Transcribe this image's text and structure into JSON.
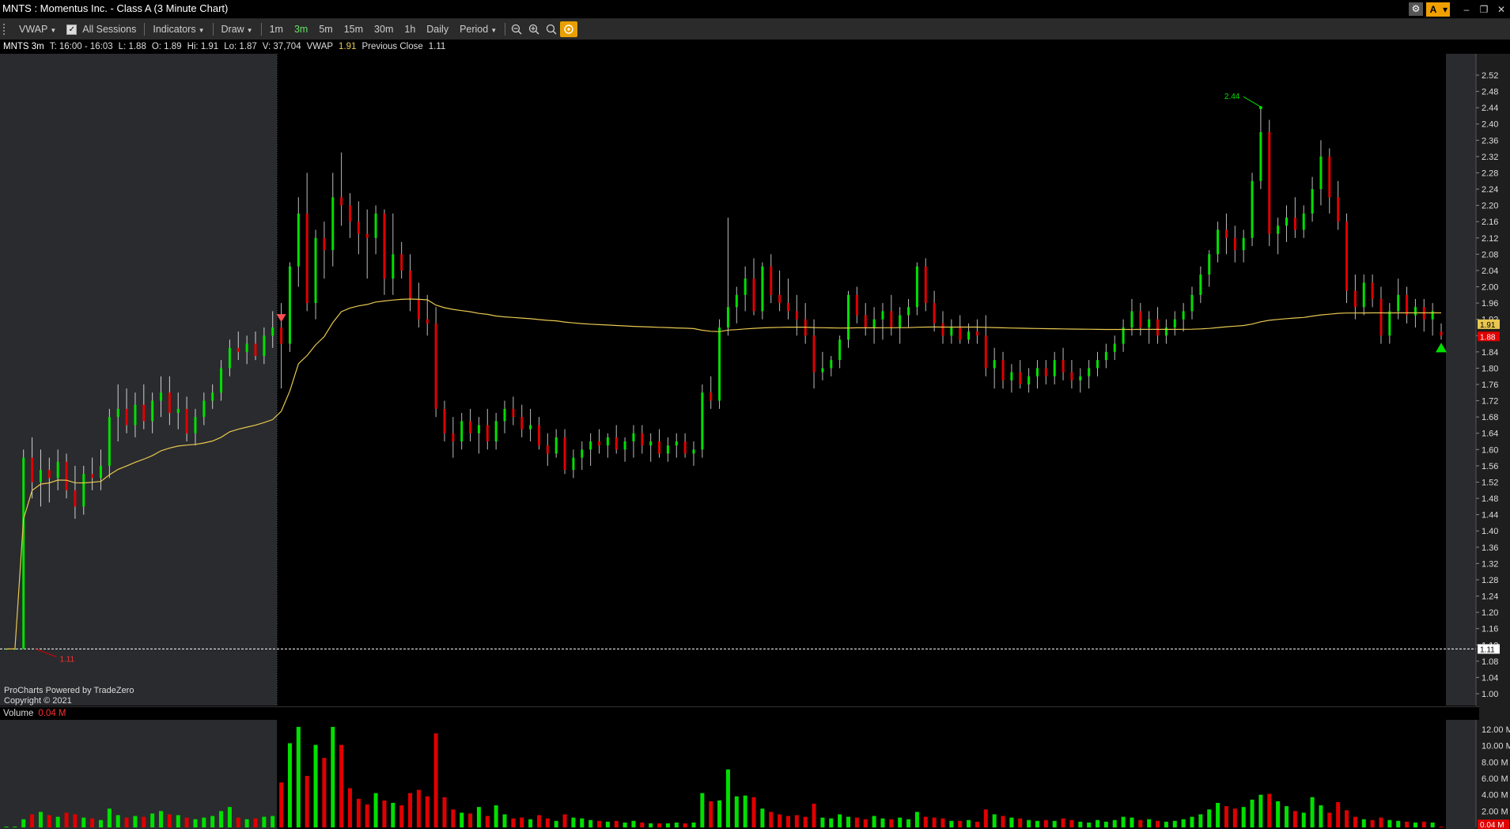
{
  "window": {
    "title": "MNTS : Momentus Inc. - Class A (3 Minute Chart)"
  },
  "toolbar": {
    "vwap": "VWAP",
    "sessions": "All Sessions",
    "indicators": "Indicators",
    "draw": "Draw",
    "timeframes": [
      "1m",
      "3m",
      "5m",
      "15m",
      "30m",
      "1h",
      "Daily"
    ],
    "active_timeframe": "3m",
    "period": "Period"
  },
  "infobar": {
    "symbol": "MNTS 3m",
    "time": "T: 16:00 - 16:03",
    "low": "L: 1.88",
    "open": "O: 1.89",
    "high": "Hi: 1.91",
    "lo": "Lo: 1.87",
    "volume": "V: 37,704",
    "vwap_label": "VWAP",
    "vwap_value": "1.91",
    "prev_close_label": "Previous Close",
    "prev_close_value": "1.11"
  },
  "footer": {
    "line1": "ProCharts Powered by TradeZero",
    "line2": "Copyright © 2021"
  },
  "volume_header": {
    "label": "Volume",
    "value": "0.04 M"
  },
  "colors": {
    "up": "#00e000",
    "down": "#e00000",
    "vwap": "#e8c850",
    "premarket_bg": "#2a2b2e",
    "axis_bg": "#1e1e1e"
  },
  "chart_data": {
    "type": "candlestick",
    "symbol": "MNTS",
    "interval": "3m",
    "yaxis": {
      "ticks": [
        1.0,
        1.04,
        1.08,
        1.12,
        1.16,
        1.2,
        1.24,
        1.28,
        1.32,
        1.36,
        1.4,
        1.44,
        1.48,
        1.52,
        1.56,
        1.6,
        1.64,
        1.68,
        1.72,
        1.76,
        1.8,
        1.84,
        1.88,
        1.92,
        1.96,
        2.0,
        2.04,
        2.08,
        2.12,
        2.16,
        2.2,
        2.24,
        2.28,
        2.32,
        2.36,
        2.4,
        2.44,
        2.48,
        2.52
      ],
      "ylim": [
        1.0,
        2.52
      ]
    },
    "previous_close": 1.11,
    "annotations": [
      {
        "text": "2.44",
        "value": 2.44
      },
      {
        "text": "1.11",
        "value": 1.11
      }
    ],
    "price_labels": {
      "vwap": "1.91",
      "last": "1.88",
      "prev_close": "1.11"
    },
    "volume_axis": {
      "ticks": [
        "12.00 M",
        "10.00 M",
        "8.00 M",
        "6.00 M",
        "4.00 M",
        "2.00 M"
      ],
      "tick_values": [
        12,
        10,
        8,
        6,
        4,
        2
      ],
      "last": "0.04 M"
    },
    "candles": [
      [
        1.11,
        1.11,
        1.11,
        1.11,
        0.001
      ],
      [
        1.11,
        1.11,
        1.11,
        1.11,
        0.001
      ],
      [
        1.11,
        1.6,
        1.11,
        1.58,
        1.0
      ],
      [
        1.58,
        1.63,
        1.48,
        1.52,
        1.6
      ],
      [
        1.52,
        1.6,
        1.46,
        1.55,
        1.9
      ],
      [
        1.55,
        1.58,
        1.47,
        1.53,
        1.5
      ],
      [
        1.53,
        1.6,
        1.5,
        1.57,
        1.3
      ],
      [
        1.57,
        1.59,
        1.48,
        1.5,
        1.8
      ],
      [
        1.5,
        1.56,
        1.43,
        1.46,
        1.6
      ],
      [
        1.46,
        1.56,
        1.44,
        1.54,
        1.2
      ],
      [
        1.54,
        1.58,
        1.5,
        1.53,
        1.1
      ],
      [
        1.53,
        1.6,
        1.5,
        1.56,
        0.9
      ],
      [
        1.56,
        1.7,
        1.53,
        1.68,
        2.3
      ],
      [
        1.68,
        1.76,
        1.62,
        1.7,
        1.5
      ],
      [
        1.7,
        1.75,
        1.64,
        1.66,
        1.2
      ],
      [
        1.66,
        1.74,
        1.63,
        1.71,
        1.4
      ],
      [
        1.71,
        1.76,
        1.65,
        1.67,
        1.3
      ],
      [
        1.67,
        1.74,
        1.64,
        1.72,
        1.7
      ],
      [
        1.72,
        1.78,
        1.68,
        1.74,
        2.0
      ],
      [
        1.74,
        1.78,
        1.66,
        1.69,
        1.6
      ],
      [
        1.69,
        1.74,
        1.65,
        1.7,
        1.5
      ],
      [
        1.7,
        1.73,
        1.62,
        1.64,
        1.2
      ],
      [
        1.64,
        1.7,
        1.61,
        1.68,
        1.0
      ],
      [
        1.68,
        1.74,
        1.66,
        1.72,
        1.2
      ],
      [
        1.72,
        1.76,
        1.7,
        1.74,
        1.4
      ],
      [
        1.74,
        1.82,
        1.72,
        1.8,
        2.0
      ],
      [
        1.8,
        1.87,
        1.78,
        1.85,
        2.5
      ],
      [
        1.85,
        1.89,
        1.82,
        1.84,
        1.2
      ],
      [
        1.84,
        1.88,
        1.81,
        1.86,
        1.0
      ],
      [
        1.86,
        1.89,
        1.82,
        1.83,
        1.1
      ],
      [
        1.83,
        1.9,
        1.81,
        1.88,
        1.3
      ],
      [
        1.88,
        1.94,
        1.85,
        1.9,
        1.4
      ],
      [
        1.9,
        1.96,
        1.75,
        1.86,
        5.5
      ],
      [
        1.86,
        2.06,
        1.84,
        2.05,
        10.3
      ],
      [
        2.05,
        2.22,
        2.0,
        2.18,
        12.3
      ],
      [
        2.18,
        2.28,
        1.94,
        1.96,
        6.3
      ],
      [
        1.96,
        2.14,
        1.92,
        2.12,
        10.1
      ],
      [
        2.12,
        2.16,
        2.02,
        2.09,
        8.5
      ],
      [
        2.09,
        2.28,
        2.05,
        2.22,
        12.3
      ],
      [
        2.22,
        2.33,
        2.15,
        2.2,
        10.1
      ],
      [
        2.2,
        2.23,
        2.12,
        2.16,
        4.8
      ],
      [
        2.16,
        2.21,
        2.08,
        2.13,
        3.5
      ],
      [
        2.13,
        2.19,
        2.02,
        2.12,
        2.8
      ],
      [
        2.12,
        2.2,
        2.08,
        2.18,
        4.2
      ],
      [
        2.18,
        2.19,
        1.98,
        2.02,
        3.3
      ],
      [
        2.02,
        2.18,
        1.98,
        2.08,
        3.0
      ],
      [
        2.08,
        2.11,
        2.02,
        2.04,
        2.7
      ],
      [
        2.04,
        2.08,
        1.94,
        1.97,
        4.2
      ],
      [
        1.97,
        2.01,
        1.9,
        1.92,
        4.6
      ],
      [
        1.92,
        1.98,
        1.88,
        1.91,
        3.8
      ],
      [
        1.91,
        1.95,
        1.68,
        1.7,
        11.5
      ],
      [
        1.7,
        1.72,
        1.62,
        1.64,
        3.7
      ],
      [
        1.64,
        1.68,
        1.58,
        1.62,
        2.2
      ],
      [
        1.62,
        1.69,
        1.6,
        1.67,
        1.8
      ],
      [
        1.67,
        1.7,
        1.62,
        1.64,
        1.7
      ],
      [
        1.64,
        1.68,
        1.59,
        1.66,
        2.5
      ],
      [
        1.66,
        1.7,
        1.6,
        1.62,
        1.4
      ],
      [
        1.62,
        1.69,
        1.6,
        1.67,
        2.7
      ],
      [
        1.67,
        1.72,
        1.64,
        1.7,
        1.6
      ],
      [
        1.7,
        1.73,
        1.66,
        1.68,
        1.1
      ],
      [
        1.68,
        1.71,
        1.63,
        1.65,
        1.2
      ],
      [
        1.65,
        1.7,
        1.62,
        1.66,
        1.0
      ],
      [
        1.66,
        1.68,
        1.6,
        1.61,
        1.5
      ],
      [
        1.61,
        1.64,
        1.56,
        1.59,
        1.1
      ],
      [
        1.59,
        1.65,
        1.58,
        1.63,
        0.8
      ],
      [
        1.63,
        1.65,
        1.54,
        1.55,
        1.6
      ],
      [
        1.55,
        1.6,
        1.53,
        1.58,
        1.2
      ],
      [
        1.58,
        1.62,
        1.55,
        1.6,
        1.1
      ],
      [
        1.6,
        1.64,
        1.56,
        1.62,
        0.9
      ],
      [
        1.62,
        1.65,
        1.59,
        1.61,
        0.8
      ],
      [
        1.61,
        1.64,
        1.58,
        1.63,
        0.7
      ],
      [
        1.63,
        1.66,
        1.59,
        1.6,
        0.8
      ],
      [
        1.6,
        1.63,
        1.57,
        1.62,
        0.6
      ],
      [
        1.62,
        1.66,
        1.58,
        1.64,
        0.8
      ],
      [
        1.64,
        1.66,
        1.59,
        1.61,
        0.6
      ],
      [
        1.61,
        1.64,
        1.57,
        1.62,
        0.5
      ],
      [
        1.62,
        1.65,
        1.58,
        1.59,
        0.5
      ],
      [
        1.59,
        1.63,
        1.57,
        1.61,
        0.5
      ],
      [
        1.61,
        1.64,
        1.58,
        1.62,
        0.6
      ],
      [
        1.62,
        1.64,
        1.58,
        1.59,
        0.5
      ],
      [
        1.59,
        1.62,
        1.56,
        1.6,
        0.6
      ],
      [
        1.6,
        1.76,
        1.58,
        1.74,
        4.2
      ],
      [
        1.74,
        1.78,
        1.7,
        1.72,
        3.2
      ],
      [
        1.72,
        1.92,
        1.7,
        1.9,
        3.3
      ],
      [
        1.9,
        2.17,
        1.88,
        1.95,
        7.1
      ],
      [
        1.95,
        2.0,
        1.91,
        1.98,
        3.8
      ],
      [
        1.98,
        2.05,
        1.94,
        2.02,
        3.9
      ],
      [
        2.02,
        2.07,
        1.93,
        1.94,
        3.7
      ],
      [
        1.94,
        2.06,
        1.92,
        2.05,
        2.3
      ],
      [
        2.05,
        2.08,
        1.96,
        1.98,
        1.9
      ],
      [
        1.98,
        2.04,
        1.94,
        1.96,
        1.6
      ],
      [
        1.96,
        2.02,
        1.92,
        1.94,
        1.4
      ],
      [
        1.94,
        1.98,
        1.88,
        1.92,
        1.5
      ],
      [
        1.92,
        1.96,
        1.86,
        1.88,
        1.3
      ],
      [
        1.88,
        1.92,
        1.75,
        1.79,
        2.9
      ],
      [
        1.79,
        1.84,
        1.77,
        1.8,
        1.2
      ],
      [
        1.8,
        1.83,
        1.78,
        1.82,
        1.1
      ],
      [
        1.82,
        1.88,
        1.8,
        1.87,
        1.6
      ],
      [
        1.87,
        1.99,
        1.85,
        1.98,
        1.3
      ],
      [
        1.98,
        2.0,
        1.91,
        1.93,
        1.2
      ],
      [
        1.93,
        1.96,
        1.88,
        1.9,
        1.0
      ],
      [
        1.9,
        1.95,
        1.86,
        1.92,
        1.4
      ],
      [
        1.92,
        1.96,
        1.87,
        1.94,
        1.1
      ],
      [
        1.94,
        1.98,
        1.88,
        1.9,
        1.0
      ],
      [
        1.9,
        1.95,
        1.86,
        1.93,
        1.2
      ],
      [
        1.93,
        1.97,
        1.9,
        1.95,
        1.0
      ],
      [
        1.95,
        2.06,
        1.93,
        2.05,
        1.9
      ],
      [
        2.05,
        2.07,
        1.94,
        1.96,
        1.3
      ],
      [
        1.96,
        1.99,
        1.89,
        1.91,
        1.2
      ],
      [
        1.91,
        1.94,
        1.86,
        1.88,
        1.1
      ],
      [
        1.88,
        1.92,
        1.86,
        1.9,
        0.8
      ],
      [
        1.9,
        1.93,
        1.86,
        1.87,
        0.8
      ],
      [
        1.87,
        1.91,
        1.86,
        1.89,
        0.9
      ],
      [
        1.89,
        1.92,
        1.86,
        1.88,
        0.7
      ],
      [
        1.88,
        1.93,
        1.78,
        1.8,
        2.2
      ],
      [
        1.8,
        1.85,
        1.75,
        1.82,
        1.6
      ],
      [
        1.82,
        1.84,
        1.75,
        1.77,
        1.4
      ],
      [
        1.77,
        1.81,
        1.74,
        1.79,
        1.2
      ],
      [
        1.79,
        1.82,
        1.75,
        1.76,
        1.1
      ],
      [
        1.76,
        1.8,
        1.74,
        1.78,
        0.9
      ],
      [
        1.78,
        1.82,
        1.75,
        1.8,
        0.8
      ],
      [
        1.8,
        1.82,
        1.76,
        1.78,
        0.9
      ],
      [
        1.78,
        1.84,
        1.76,
        1.82,
        0.8
      ],
      [
        1.82,
        1.85,
        1.77,
        1.79,
        1.1
      ],
      [
        1.79,
        1.82,
        1.75,
        1.77,
        0.9
      ],
      [
        1.77,
        1.8,
        1.74,
        1.78,
        0.7
      ],
      [
        1.78,
        1.82,
        1.75,
        1.8,
        0.6
      ],
      [
        1.8,
        1.84,
        1.78,
        1.82,
        0.9
      ],
      [
        1.82,
        1.86,
        1.8,
        1.84,
        0.7
      ],
      [
        1.84,
        1.88,
        1.82,
        1.86,
        0.9
      ],
      [
        1.86,
        1.92,
        1.84,
        1.9,
        1.3
      ],
      [
        1.9,
        1.97,
        1.88,
        1.94,
        1.2
      ],
      [
        1.94,
        1.96,
        1.88,
        1.9,
        0.9
      ],
      [
        1.9,
        1.94,
        1.86,
        1.92,
        1.0
      ],
      [
        1.92,
        1.95,
        1.86,
        1.88,
        0.8
      ],
      [
        1.88,
        1.92,
        1.86,
        1.9,
        0.7
      ],
      [
        1.9,
        1.94,
        1.88,
        1.92,
        0.8
      ],
      [
        1.92,
        1.96,
        1.89,
        1.94,
        1.0
      ],
      [
        1.94,
        2.0,
        1.92,
        1.98,
        1.3
      ],
      [
        1.98,
        2.05,
        1.96,
        2.03,
        1.6
      ],
      [
        2.03,
        2.09,
        2.0,
        2.08,
        2.2
      ],
      [
        2.08,
        2.16,
        2.06,
        2.14,
        3.0
      ],
      [
        2.14,
        2.18,
        2.08,
        2.12,
        2.6
      ],
      [
        2.12,
        2.15,
        2.06,
        2.09,
        2.3
      ],
      [
        2.09,
        2.14,
        2.06,
        2.12,
        2.5
      ],
      [
        2.12,
        2.28,
        2.1,
        2.26,
        3.4
      ],
      [
        2.26,
        2.44,
        2.24,
        2.38,
        4.0
      ],
      [
        2.38,
        2.41,
        2.1,
        2.13,
        4.1
      ],
      [
        2.13,
        2.17,
        2.08,
        2.15,
        3.2
      ],
      [
        2.15,
        2.2,
        2.11,
        2.17,
        2.6
      ],
      [
        2.17,
        2.22,
        2.12,
        2.14,
        2.0
      ],
      [
        2.14,
        2.2,
        2.12,
        2.18,
        1.8
      ],
      [
        2.18,
        2.27,
        2.16,
        2.24,
        3.7
      ],
      [
        2.24,
        2.36,
        2.2,
        2.32,
        2.7
      ],
      [
        2.32,
        2.34,
        2.18,
        2.22,
        1.8
      ],
      [
        2.22,
        2.26,
        2.14,
        2.16,
        3.1
      ],
      [
        2.16,
        2.18,
        1.96,
        1.99,
        2.1
      ],
      [
        1.99,
        2.03,
        1.92,
        1.95,
        1.3
      ],
      [
        1.95,
        2.03,
        1.93,
        2.01,
        1.0
      ],
      [
        2.01,
        2.03,
        1.95,
        1.97,
        0.9
      ],
      [
        1.97,
        2.0,
        1.86,
        1.88,
        1.2
      ],
      [
        1.88,
        1.96,
        1.86,
        1.94,
        0.9
      ],
      [
        1.94,
        2.02,
        1.92,
        1.98,
        0.8
      ],
      [
        1.98,
        2.0,
        1.91,
        1.93,
        0.7
      ],
      [
        1.93,
        1.97,
        1.9,
        1.95,
        0.6
      ],
      [
        1.95,
        1.97,
        1.89,
        1.92,
        0.7
      ],
      [
        1.92,
        1.96,
        1.88,
        1.94,
        0.6
      ],
      [
        1.89,
        1.91,
        1.87,
        1.88,
        0.04
      ]
    ],
    "candle_fields": [
      "open",
      "high",
      "low",
      "close",
      "volume_millions"
    ]
  }
}
